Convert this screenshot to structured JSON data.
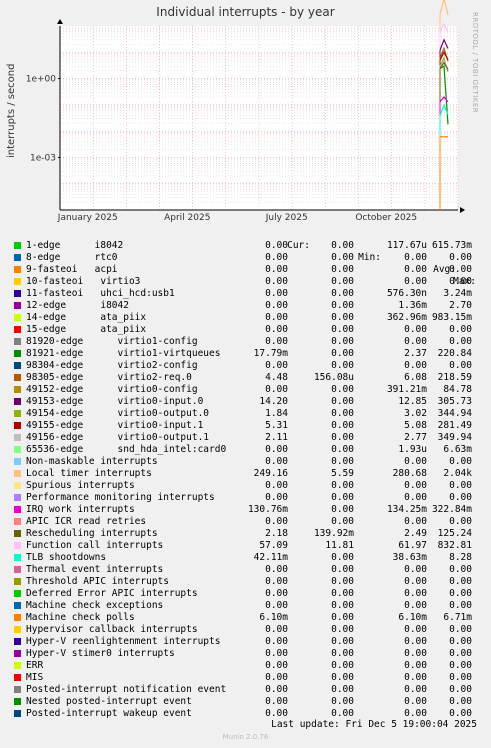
{
  "title": "Individual interrupts - by year",
  "side_label": "RRDTOOL / TOBI OETIKER",
  "last_update": "Last update: Fri Dec  5 19:00:04 2025",
  "footer": "Munin 2.0.76",
  "columns": [
    "Cur:",
    "Min:",
    "Avg:",
    "Max:"
  ],
  "legend": [
    {
      "name": "1-edge      i8042",
      "color": "#00cc00",
      "cur": "0.00",
      "min": "0.00",
      "avg": "117.67u",
      "max": "615.73m"
    },
    {
      "name": "8-edge      rtc0",
      "color": "#0066b3",
      "cur": "0.00",
      "min": "0.00",
      "avg": "0.00",
      "max": "0.00"
    },
    {
      "name": "9-fasteoi   acpi",
      "color": "#ff8000",
      "cur": "0.00",
      "min": "0.00",
      "avg": "0.00",
      "max": "0.00"
    },
    {
      "name": "10-fasteoi   virtio3",
      "color": "#ffcc00",
      "cur": "0.00",
      "min": "0.00",
      "avg": "0.00",
      "max": "0.00"
    },
    {
      "name": "11-fasteoi   uhci_hcd:usb1",
      "color": "#330099",
      "cur": "0.00",
      "min": "0.00",
      "avg": "576.30n",
      "max": "3.24m"
    },
    {
      "name": "12-edge      i8042",
      "color": "#990099",
      "cur": "0.00",
      "min": "0.00",
      "avg": "1.36m",
      "max": "2.70"
    },
    {
      "name": "14-edge      ata_piix",
      "color": "#ccff00",
      "cur": "0.00",
      "min": "0.00",
      "avg": "362.96m",
      "max": "983.15m"
    },
    {
      "name": "15-edge      ata_piix",
      "color": "#ff0000",
      "cur": "0.00",
      "min": "0.00",
      "avg": "0.00",
      "max": "0.00"
    },
    {
      "name": "81920-edge      virtio1-config",
      "color": "#808080",
      "cur": "0.00",
      "min": "0.00",
      "avg": "0.00",
      "max": "0.00"
    },
    {
      "name": "81921-edge      virtio1-virtqueues",
      "color": "#008f00",
      "cur": "17.79m",
      "min": "0.00",
      "avg": "2.37",
      "max": "220.84"
    },
    {
      "name": "98304-edge      virtio2-config",
      "color": "#00487d",
      "cur": "0.00",
      "min": "0.00",
      "avg": "0.00",
      "max": "0.00"
    },
    {
      "name": "98305-edge      virtio2-req.0",
      "color": "#b35a00",
      "cur": "4.48",
      "min": "156.08u",
      "avg": "6.08",
      "max": "218.59"
    },
    {
      "name": "49152-edge      virtio0-config",
      "color": "#b38f00",
      "cur": "0.00",
      "min": "0.00",
      "avg": "391.21m",
      "max": "84.78"
    },
    {
      "name": "49153-edge      virtio0-input.0",
      "color": "#6b006b",
      "cur": "14.20",
      "min": "0.00",
      "avg": "12.85",
      "max": "305.73"
    },
    {
      "name": "49154-edge      virtio0-output.0",
      "color": "#8fb300",
      "cur": "1.84",
      "min": "0.00",
      "avg": "3.02",
      "max": "344.94"
    },
    {
      "name": "49155-edge      virtio0-input.1",
      "color": "#b30000",
      "cur": "5.31",
      "min": "0.00",
      "avg": "5.08",
      "max": "281.49"
    },
    {
      "name": "49156-edge      virtio0-output.1",
      "color": "#bebebe",
      "cur": "2.11",
      "min": "0.00",
      "avg": "2.77",
      "max": "349.94"
    },
    {
      "name": "65536-edge      snd_hda_intel:card0",
      "color": "#80ff80",
      "cur": "0.00",
      "min": "0.00",
      "avg": "1.93u",
      "max": "6.63m"
    },
    {
      "name": "Non-maskable interrupts",
      "color": "#80c9ff",
      "cur": "0.00",
      "min": "0.00",
      "avg": "0.00",
      "max": "0.00"
    },
    {
      "name": "Local timer interrupts",
      "color": "#ffc080",
      "cur": "249.16",
      "min": "5.59",
      "avg": "280.68",
      "max": "2.04k"
    },
    {
      "name": "Spurious interrupts",
      "color": "#ffe680",
      "cur": "0.00",
      "min": "0.00",
      "avg": "0.00",
      "max": "0.00"
    },
    {
      "name": "Performance monitoring interrupts",
      "color": "#aa80ff",
      "cur": "0.00",
      "min": "0.00",
      "avg": "0.00",
      "max": "0.00"
    },
    {
      "name": "IRQ work interrupts",
      "color": "#ee00cc",
      "cur": "130.76m",
      "min": "0.00",
      "avg": "134.25m",
      "max": "322.84m"
    },
    {
      "name": "APIC ICR read retries",
      "color": "#ff8080",
      "cur": "0.00",
      "min": "0.00",
      "avg": "0.00",
      "max": "0.00"
    },
    {
      "name": "Rescheduling interrupts",
      "color": "#666600",
      "cur": "2.18",
      "min": "139.92m",
      "avg": "2.49",
      "max": "125.24"
    },
    {
      "name": "Function call interrupts",
      "color": "#ffbfff",
      "cur": "57.09",
      "min": "11.81",
      "avg": "61.97",
      "max": "832.81"
    },
    {
      "name": "TLB shootdowns",
      "color": "#00ffcc",
      "cur": "42.11m",
      "min": "0.00",
      "avg": "38.63m",
      "max": "8.28"
    },
    {
      "name": "Thermal event interrupts",
      "color": "#cc6699",
      "cur": "0.00",
      "min": "0.00",
      "avg": "0.00",
      "max": "0.00"
    },
    {
      "name": "Threshold APIC interrupts",
      "color": "#999900",
      "cur": "0.00",
      "min": "0.00",
      "avg": "0.00",
      "max": "0.00"
    },
    {
      "name": "Deferred Error APIC interrupts",
      "color": "#00cc00",
      "cur": "0.00",
      "min": "0.00",
      "avg": "0.00",
      "max": "0.00"
    },
    {
      "name": "Machine check exceptions",
      "color": "#0066b3",
      "cur": "0.00",
      "min": "0.00",
      "avg": "0.00",
      "max": "0.00"
    },
    {
      "name": "Machine check polls",
      "color": "#ff8000",
      "cur": "6.10m",
      "min": "0.00",
      "avg": "6.10m",
      "max": "6.71m"
    },
    {
      "name": "Hypervisor callback interrupts",
      "color": "#ffcc00",
      "cur": "0.00",
      "min": "0.00",
      "avg": "0.00",
      "max": "0.00"
    },
    {
      "name": "Hyper-V reenlightenment interrupts",
      "color": "#330099",
      "cur": "0.00",
      "min": "0.00",
      "avg": "0.00",
      "max": "0.00"
    },
    {
      "name": "Hyper-V stimer0 interrupts",
      "color": "#990099",
      "cur": "0.00",
      "min": "0.00",
      "avg": "0.00",
      "max": "0.00"
    },
    {
      "name": "ERR",
      "color": "#ccff00",
      "cur": "0.00",
      "min": "0.00",
      "avg": "0.00",
      "max": "0.00"
    },
    {
      "name": "MIS",
      "color": "#ff0000",
      "cur": "0.00",
      "min": "0.00",
      "avg": "0.00",
      "max": "0.00"
    },
    {
      "name": "Posted-interrupt notification event",
      "color": "#808080",
      "cur": "0.00",
      "min": "0.00",
      "avg": "0.00",
      "max": "0.00"
    },
    {
      "name": "Nested posted-interrupt event",
      "color": "#008f00",
      "cur": "0.00",
      "min": "0.00",
      "avg": "0.00",
      "max": "0.00"
    },
    {
      "name": "Posted-interrupt wakeup event",
      "color": "#00487d",
      "cur": "0.00",
      "min": "0.00",
      "avg": "0.00",
      "max": "0.00"
    }
  ],
  "chart_data": {
    "type": "line",
    "title": "Individual interrupts - by year",
    "ylabel": "interrupts / second",
    "yscale": "log",
    "ylim": [
      1e-05,
      100
    ],
    "y_ticks": [
      {
        "value": 1,
        "label": "1e+00"
      },
      {
        "value": 0.001,
        "label": "1e-03"
      }
    ],
    "x_ticks": [
      "January 2025",
      "April 2025",
      "July 2025",
      "October 2025"
    ],
    "grid": true,
    "series": [
      {
        "name": "Local timer interrupts",
        "color": "#ffc080",
        "values": [
          280,
          1100,
          260
        ]
      },
      {
        "name": "Function call interrupts",
        "color": "#ffbfff",
        "values": [
          62,
          120,
          57
        ]
      },
      {
        "name": "49153-edge      virtio0-input.0",
        "color": "#6b006b",
        "values": [
          12,
          30,
          14
        ]
      },
      {
        "name": "98305-edge      virtio2-req.0",
        "color": "#b35a00",
        "values": [
          6,
          14,
          4.5
        ]
      },
      {
        "name": "49155-edge      virtio0-input.1",
        "color": "#b30000",
        "values": [
          5,
          10,
          5.3
        ]
      },
      {
        "name": "49154-edge      virtio0-output.0",
        "color": "#8fb300",
        "values": [
          3,
          6,
          1.8
        ]
      },
      {
        "name": "49156-edge      virtio0-output.1",
        "color": "#bebebe",
        "values": [
          2.8,
          5,
          2.1
        ]
      },
      {
        "name": "81921-edge      virtio1-virtqueues",
        "color": "#008f00",
        "values": [
          2.4,
          3,
          0.018
        ]
      },
      {
        "name": "Rescheduling interrupts",
        "color": "#666600",
        "values": [
          2.5,
          4,
          2.2
        ]
      },
      {
        "name": "IRQ work interrupts",
        "color": "#ee00cc",
        "values": [
          0.13,
          0.2,
          0.13
        ]
      },
      {
        "name": "TLB shootdowns",
        "color": "#00ffcc",
        "values": [
          0.039,
          0.1,
          0.042
        ]
      },
      {
        "name": "Machine check polls",
        "color": "#ff8000",
        "values": [
          0.0061,
          0.0061,
          0.0061
        ]
      }
    ]
  }
}
